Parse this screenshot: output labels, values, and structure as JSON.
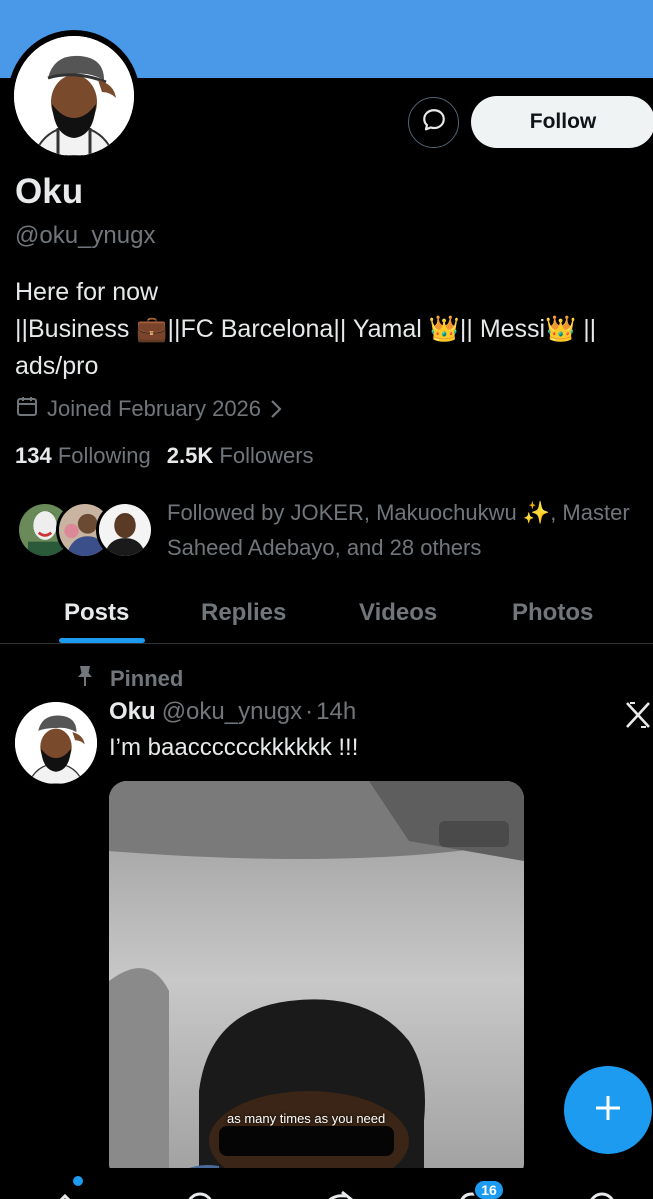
{
  "profile": {
    "name": "Oku",
    "handle": "@oku_ynugx",
    "bio_lines": [
      "Here for now",
      "||Business 💼||FC Barcelona|| Yamal 👑|| Messi👑 ||",
      "ads/pro"
    ],
    "joined": "Joined February 2026",
    "following_count": "134",
    "following_label": "Following",
    "followers_count": "2.5K",
    "followers_label": "Followers",
    "followed_by": "Followed by JOKER, Makuochukwu ✨, Master Saheed Adebayo, and 28 others"
  },
  "actions": {
    "follow_label": "Follow"
  },
  "tabs": [
    {
      "label": "Posts",
      "active": true
    },
    {
      "label": "Replies",
      "active": false
    },
    {
      "label": "Videos",
      "active": false
    },
    {
      "label": "Photos",
      "active": false
    }
  ],
  "post": {
    "pinned_label": "Pinned",
    "author": "Oku",
    "handle": "@oku_ynugx",
    "separator": "·",
    "time": "14h",
    "text": "I’m baacccccckkkkkk !!!",
    "video_caption": "as many times as you need"
  },
  "nav": {
    "notifications_badge": "16"
  },
  "colors": {
    "banner": "#4a99e9",
    "accent": "#1d9bf0",
    "background": "#000000",
    "secondary_text": "#71767b"
  },
  "icons": [
    "message-icon",
    "calendar-icon",
    "chevron-right-icon",
    "pin-icon",
    "grok-x-icon",
    "plus-icon",
    "home-icon",
    "search-icon",
    "grok-icon",
    "bell-icon",
    "mail-icon"
  ]
}
